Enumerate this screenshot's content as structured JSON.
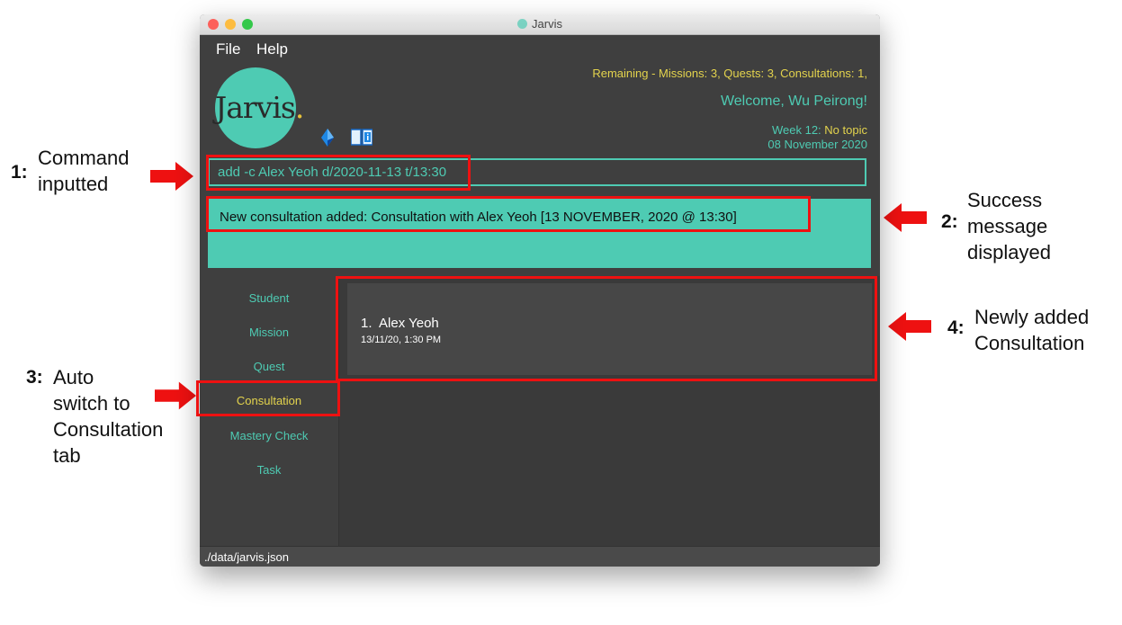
{
  "window": {
    "title": "Jarvis"
  },
  "menu": {
    "file": "File",
    "help": "Help"
  },
  "logo": {
    "text": "Jarvis",
    "dot": "."
  },
  "header": {
    "remaining": "Remaining - Missions: 3, Quests: 3, Consultations: 1,",
    "welcome": "Welcome, Wu Peirong!",
    "week_label": "Week 12:",
    "week_topic": "No topic",
    "date": "08 November 2020"
  },
  "command": {
    "value": "add -c Alex Yeoh d/2020-11-13 t/13:30"
  },
  "result": {
    "message": "New consultation added: Consultation with Alex Yeoh [13 NOVEMBER, 2020 @ 13:30]"
  },
  "tabs": [
    {
      "label": "Student"
    },
    {
      "label": "Mission"
    },
    {
      "label": "Quest"
    },
    {
      "label": "Consultation",
      "active": true
    },
    {
      "label": "Mastery Check"
    },
    {
      "label": "Task"
    }
  ],
  "consultations": [
    {
      "index": "1.",
      "name": "Alex Yeoh",
      "datetime": "13/11/20, 1:30 PM"
    }
  ],
  "statusbar": {
    "path": "./data/jarvis.json"
  },
  "annotations": {
    "a1": {
      "num": "1:",
      "line1": "Command",
      "line2": "inputted"
    },
    "a2": {
      "num": "2:",
      "line1": "Success",
      "line2": "message",
      "line3": "displayed"
    },
    "a3": {
      "num": "3:",
      "line1": "Auto",
      "line2": "switch to",
      "line3": "Consultation",
      "line4": "tab"
    },
    "a4": {
      "num": "4:",
      "line1": "Newly added",
      "line2": "Consultation"
    }
  },
  "icons": {
    "gem": "gem-icon",
    "book": "book-icon"
  },
  "colors": {
    "accent": "#4ecbb3",
    "highlight": "#e3d34d",
    "annotation": "#ee1111"
  }
}
